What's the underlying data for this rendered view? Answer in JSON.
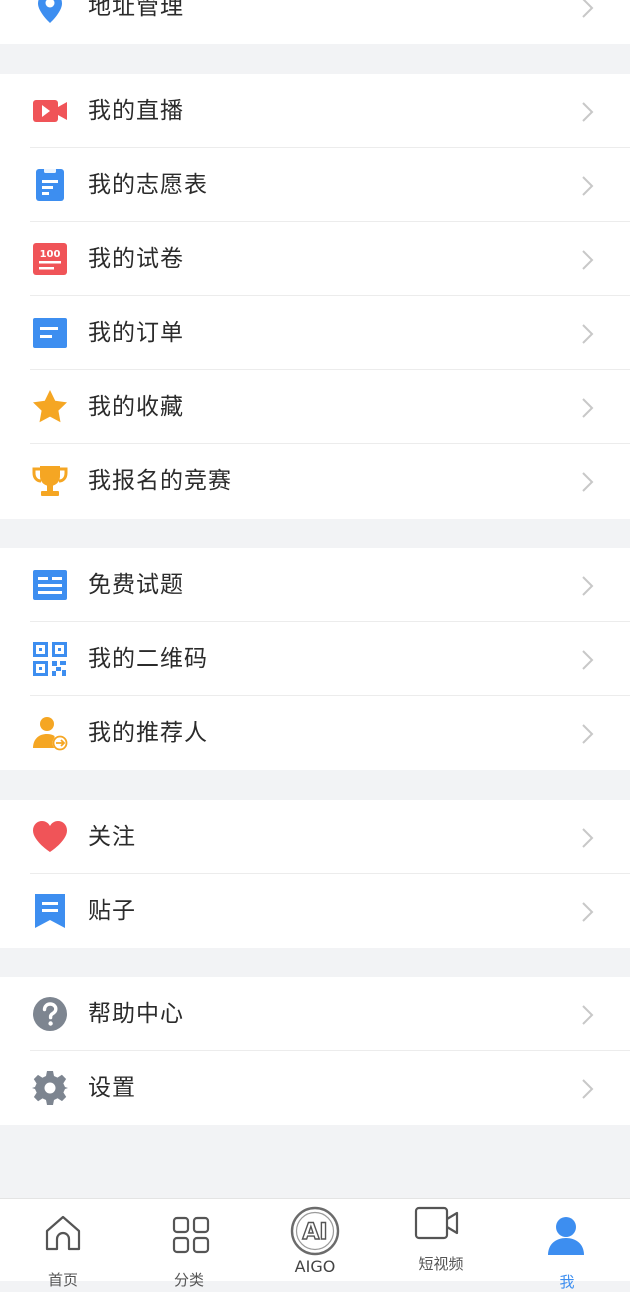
{
  "menu": {
    "address": "地址管理",
    "live": "我的直播",
    "volunteer": "我的志愿表",
    "papers": "我的试卷",
    "orders": "我的订单",
    "favorites": "我的收藏",
    "competitions": "我报名的竞赛",
    "free_questions": "免费试题",
    "qrcode": "我的二维码",
    "referrer": "我的推荐人",
    "follow": "关注",
    "posts": "贴子",
    "help": "帮助中心",
    "settings": "设置"
  },
  "tabbar": {
    "home": "首页",
    "category": "分类",
    "aigo": "AIGO",
    "ai_badge": "AI",
    "short_video": "短视频",
    "me": "我",
    "active": "me"
  },
  "colors": {
    "blue": "#3d8ef0",
    "red": "#f05458",
    "orange": "#f5a623",
    "gray": "#7d8590",
    "tab_active": "#3d8ef0"
  }
}
